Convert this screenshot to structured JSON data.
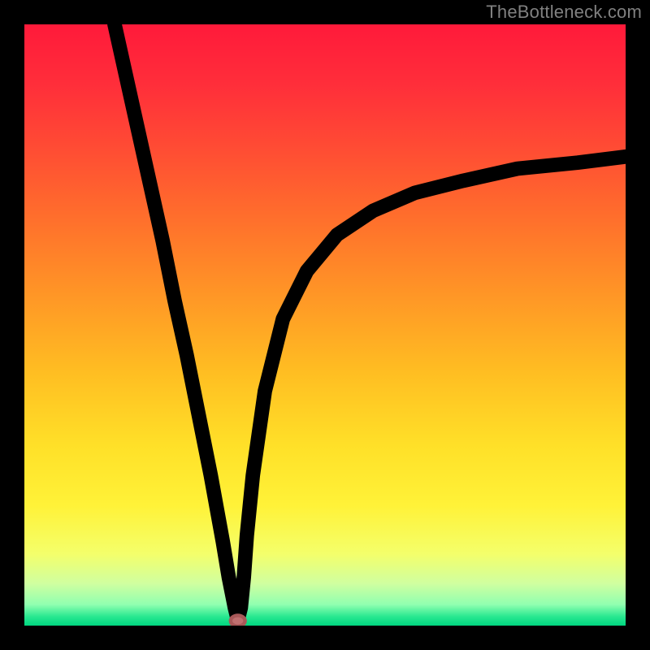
{
  "watermark": "TheBottleneck.com",
  "chart_data": {
    "type": "line",
    "title": "",
    "xlabel": "",
    "ylabel": "",
    "xlim": [
      0,
      100
    ],
    "ylim": [
      0,
      100
    ],
    "series": [
      {
        "name": "bottleneck-curve",
        "x": [
          15,
          17,
          19,
          21,
          23,
          25,
          27,
          29,
          31,
          33,
          34,
          35,
          35.5,
          36,
          36.5,
          37,
          38,
          40,
          43,
          47,
          52,
          58,
          65,
          73,
          82,
          92,
          100
        ],
        "y": [
          100,
          91,
          82,
          73,
          64,
          54,
          45,
          35,
          25,
          14,
          8,
          3,
          1,
          3,
          8,
          15,
          25,
          39,
          51,
          59,
          65,
          69,
          72,
          74,
          76,
          77,
          78
        ]
      }
    ],
    "marker": {
      "x": 35.5,
      "y": 0.8,
      "color": "#c07070"
    },
    "gradient_stops": [
      {
        "pos": 0.0,
        "color": "#ff1a3a"
      },
      {
        "pos": 0.1,
        "color": "#ff2e3a"
      },
      {
        "pos": 0.2,
        "color": "#ff4a34"
      },
      {
        "pos": 0.32,
        "color": "#ff6e2c"
      },
      {
        "pos": 0.45,
        "color": "#ff9626"
      },
      {
        "pos": 0.58,
        "color": "#ffbe22"
      },
      {
        "pos": 0.7,
        "color": "#ffe028"
      },
      {
        "pos": 0.8,
        "color": "#fff238"
      },
      {
        "pos": 0.88,
        "color": "#f4ff6a"
      },
      {
        "pos": 0.93,
        "color": "#d0ffa0"
      },
      {
        "pos": 0.965,
        "color": "#90ffb0"
      },
      {
        "pos": 0.985,
        "color": "#28e890"
      },
      {
        "pos": 1.0,
        "color": "#00d680"
      }
    ]
  }
}
